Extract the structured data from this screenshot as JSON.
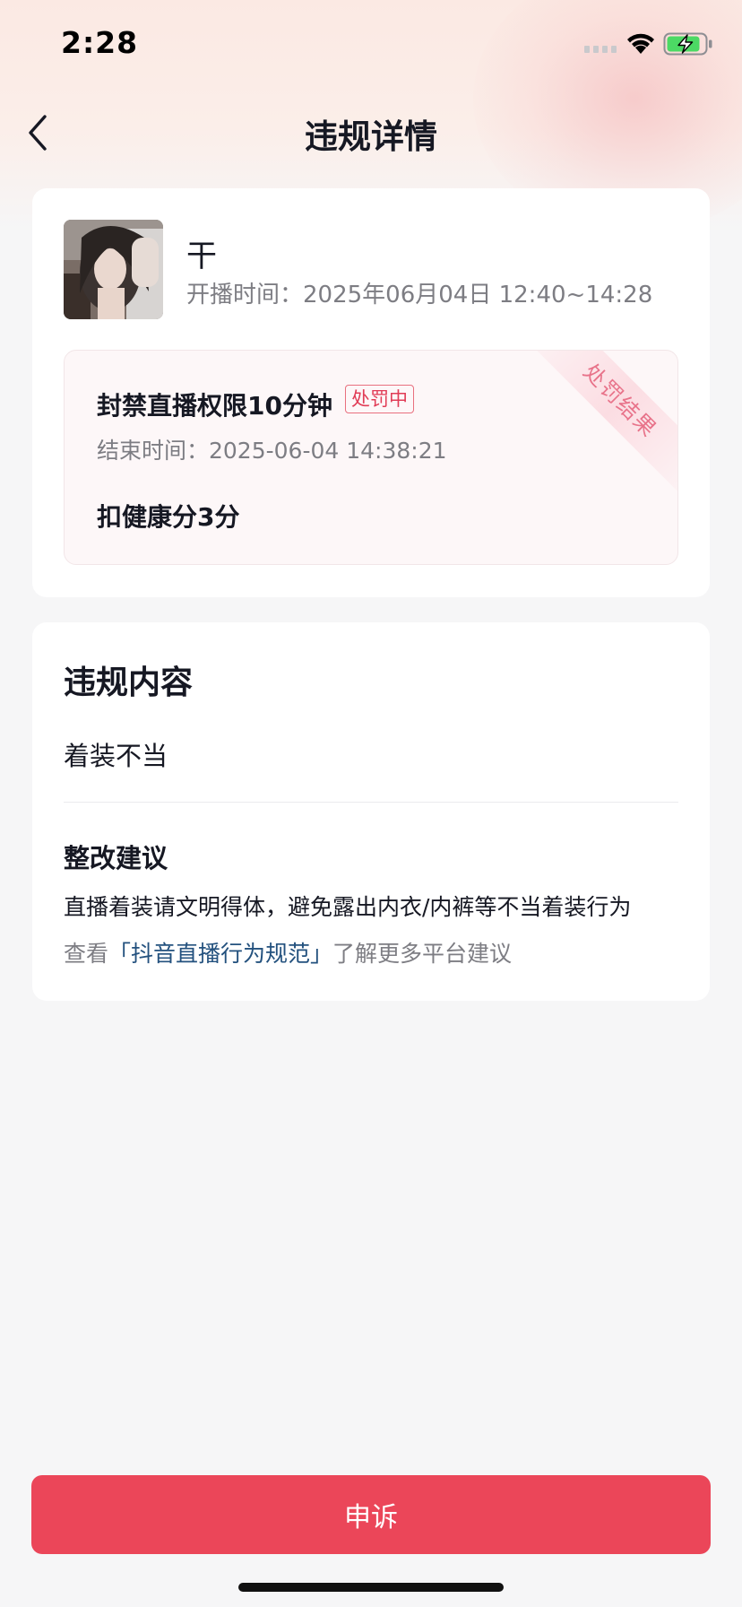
{
  "status_bar": {
    "time": "2:28"
  },
  "nav": {
    "title": "违规详情",
    "back_icon": "chevron-left-icon"
  },
  "broadcast": {
    "user_name": "干",
    "live_time": "开播时间：2025年06月04日 12:40~14:28"
  },
  "penalty": {
    "title": "封禁直播权限10分钟",
    "status_badge": "处罚中",
    "end_time": "结束时间：2025-06-04 14:38:21",
    "health_deduction": "扣健康分3分",
    "ribbon_label": "处罚结果"
  },
  "violation": {
    "section_title": "违规内容",
    "item": "着装不当",
    "suggestion_title": "整改建议",
    "suggestion_text": "直播着装请文明得体，避免露出内衣/内裤等不当着装行为",
    "more_prefix": "查看",
    "more_link": "「抖音直播行为规范」",
    "more_suffix": "了解更多平台建议"
  },
  "actions": {
    "appeal_label": "申诉"
  },
  "colors": {
    "accent": "#eb4659",
    "badge_red": "#e13c56",
    "link_blue": "#23517e",
    "secondary_text": "#7d7d83",
    "battery_green": "#4cd964"
  }
}
